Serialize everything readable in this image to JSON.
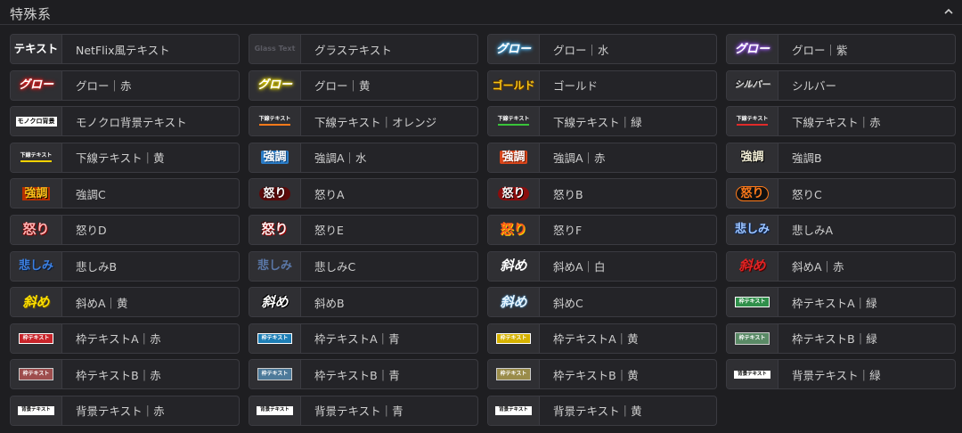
{
  "section": {
    "title": "特殊系",
    "collapse_icon": "chevron-up-icon"
  },
  "items": [
    {
      "thumb": "テキスト",
      "label": "NetFlix風テキスト",
      "style": "netflix"
    },
    {
      "thumb": "Glass Text",
      "label": "グラステキスト",
      "style": "glass"
    },
    {
      "thumb": "グロー",
      "label": "グロー｜水",
      "style": "glow-water"
    },
    {
      "thumb": "グロー",
      "label": "グロー｜紫",
      "style": "glow-purple"
    },
    {
      "thumb": "グロー",
      "label": "グロー｜赤",
      "style": "glow-red"
    },
    {
      "thumb": "グロー",
      "label": "グロー｜黄",
      "style": "glow-yellow"
    },
    {
      "thumb": "ゴールド",
      "label": "ゴールド",
      "style": "gold"
    },
    {
      "thumb": "シルバー",
      "label": "シルバー",
      "style": "silver"
    },
    {
      "thumb": "モノクロ背景",
      "label": "モノクロ背景テキスト",
      "style": "mono"
    },
    {
      "thumb": "下線テキスト",
      "label": "下線テキスト｜オレンジ",
      "style": "uline orange"
    },
    {
      "thumb": "下線テキスト",
      "label": "下線テキスト｜緑",
      "style": "uline green"
    },
    {
      "thumb": "下線テキスト",
      "label": "下線テキスト｜赤",
      "style": "uline red"
    },
    {
      "thumb": "下線テキスト",
      "label": "下線テキスト｜黄",
      "style": "uline yellow"
    },
    {
      "thumb": "強調",
      "label": "強調A｜水",
      "style": "kyo-water"
    },
    {
      "thumb": "強調",
      "label": "強調A｜赤",
      "style": "kyo-red"
    },
    {
      "thumb": "強調",
      "label": "強調B",
      "style": "kyo-b"
    },
    {
      "thumb": "強調",
      "label": "強調C",
      "style": "kyo-c"
    },
    {
      "thumb": "怒り",
      "label": "怒りA",
      "style": "ikari-a"
    },
    {
      "thumb": "怒り",
      "label": "怒りB",
      "style": "ikari-b"
    },
    {
      "thumb": "怒り",
      "label": "怒りC",
      "style": "ikari-c"
    },
    {
      "thumb": "怒り",
      "label": "怒りD",
      "style": "ikari-d"
    },
    {
      "thumb": "怒り",
      "label": "怒りE",
      "style": "ikari-e"
    },
    {
      "thumb": "怒り",
      "label": "怒りF",
      "style": "ikari-f"
    },
    {
      "thumb": "悲しみ",
      "label": "悲しみA",
      "style": "kanashi-a"
    },
    {
      "thumb": "悲しみ",
      "label": "悲しみB",
      "style": "kanashi-b"
    },
    {
      "thumb": "悲しみ",
      "label": "悲しみC",
      "style": "kanashi-c"
    },
    {
      "thumb": "斜め",
      "label": "斜めA｜白",
      "style": "naname-white"
    },
    {
      "thumb": "斜め",
      "label": "斜めA｜赤",
      "style": "naname-red"
    },
    {
      "thumb": "斜め",
      "label": "斜めA｜黄",
      "style": "naname-yellow"
    },
    {
      "thumb": "斜め",
      "label": "斜めB",
      "style": "naname-b"
    },
    {
      "thumb": "斜め",
      "label": "斜めC",
      "style": "naname-c"
    },
    {
      "thumb": "枠テキスト",
      "label": "枠テキストA｜緑",
      "style": "waku waku-green"
    },
    {
      "thumb": "枠テキスト",
      "label": "枠テキストA｜赤",
      "style": "waku waku-red"
    },
    {
      "thumb": "枠テキスト",
      "label": "枠テキストA｜青",
      "style": "waku waku-blue"
    },
    {
      "thumb": "枠テキスト",
      "label": "枠テキストA｜黄",
      "style": "waku waku-yellow"
    },
    {
      "thumb": "枠テキスト",
      "label": "枠テキストB｜緑",
      "style": "wakub wakub-green"
    },
    {
      "thumb": "枠テキスト",
      "label": "枠テキストB｜赤",
      "style": "wakub wakub-red"
    },
    {
      "thumb": "枠テキスト",
      "label": "枠テキストB｜青",
      "style": "wakub wakub-blue"
    },
    {
      "thumb": "枠テキスト",
      "label": "枠テキストB｜黄",
      "style": "wakub wakub-yellow"
    },
    {
      "thumb": "背景テキスト",
      "label": "背景テキスト｜緑",
      "style": "haikei"
    },
    {
      "thumb": "背景テキスト",
      "label": "背景テキスト｜赤",
      "style": "haikei"
    },
    {
      "thumb": "背景テキスト",
      "label": "背景テキスト｜青",
      "style": "haikei"
    },
    {
      "thumb": "背景テキスト",
      "label": "背景テキスト｜黄",
      "style": "haikei"
    }
  ]
}
